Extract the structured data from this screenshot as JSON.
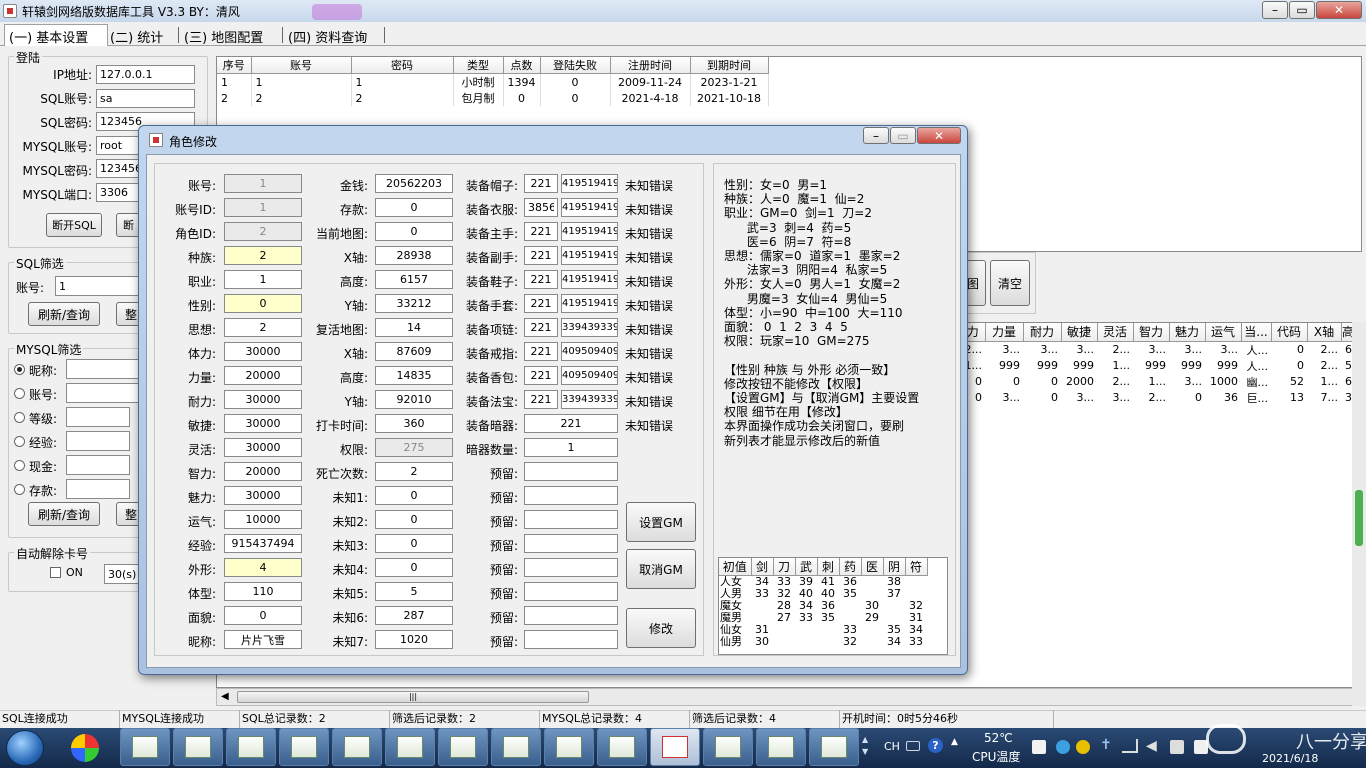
{
  "window": {
    "title": "轩辕剑网络版数据库工具 V3.3      BY：清风"
  },
  "tabs": [
    "(一) 基本设置",
    "(二) 统计",
    "(三) 地图配置",
    "(四) 资料查询"
  ],
  "login": {
    "group": "登陆",
    "fields": [
      {
        "label": "IP地址:",
        "value": "127.0.0.1"
      },
      {
        "label": "SQL账号:",
        "value": "sa"
      },
      {
        "label": "SQL密码:",
        "value": "123456"
      },
      {
        "label": "MYSQL账号:",
        "value": "root"
      },
      {
        "label": "MYSQL密码:",
        "value": "123456"
      },
      {
        "label": "MYSQL端口:",
        "value": "3306"
      }
    ],
    "disconnect_btn": "断开SQL",
    "disconnect2_btn": "断"
  },
  "sql_filter": {
    "group": "SQL筛选",
    "account_label": "账号:",
    "account_value": "1",
    "refresh_btn": "刷新/查询",
    "other_btn": "整"
  },
  "mysql_filter": {
    "group": "MYSQL筛选",
    "options": [
      "昵称:",
      "账号:",
      "等级:",
      "经验:",
      "现金:",
      "存款:"
    ],
    "refresh_btn": "刷新/查询",
    "other_btn": "整"
  },
  "auto_unlock": {
    "group": "自动解除卡号",
    "checkbox": "ON",
    "interval": "30(s)"
  },
  "sql_table": {
    "headers": [
      "序号",
      "账号",
      "密码",
      "类型",
      "点数",
      "登陆失败",
      "注册时间",
      "到期时间"
    ],
    "rows": [
      [
        "1",
        "1",
        "1",
        "小时制",
        "1394",
        "0",
        "2009-11-24",
        "2023-1-21"
      ],
      [
        "2",
        "2",
        "2",
        "包月制",
        "0",
        "0",
        "2021-4-18",
        "2021-10-18"
      ]
    ]
  },
  "right_buttons": {
    "partial": "图",
    "clear": "清空"
  },
  "mysql_table": {
    "headers": [
      "力",
      "力量",
      "耐力",
      "敏捷",
      "灵活",
      "智力",
      "魅力",
      "运气",
      "当...",
      "代码",
      "X轴",
      "高"
    ],
    "rows": [
      [
        "2...",
        "3...",
        "3...",
        "3...",
        "2...",
        "3...",
        "3...",
        "3...",
        "人...",
        "0",
        "2...",
        "6"
      ],
      [
        "1...",
        "999",
        "999",
        "999",
        "1...",
        "999",
        "999",
        "999",
        "人...",
        "0",
        "2...",
        "5"
      ],
      [
        "0",
        "0",
        "0",
        "2000",
        "2...",
        "1...",
        "3...",
        "1000",
        "幽...",
        "52",
        "1...",
        "6"
      ],
      [
        "0",
        "3...",
        "0",
        "3...",
        "3...",
        "2...",
        "0",
        "36",
        "巨...",
        "13",
        "7...",
        "3"
      ]
    ]
  },
  "dialog": {
    "title": "角色修改",
    "col1": [
      {
        "label": "账号:",
        "value": "1",
        "state": "dis"
      },
      {
        "label": "账号ID:",
        "value": "1",
        "state": "dis"
      },
      {
        "label": "角色ID:",
        "value": "2",
        "state": "dis"
      },
      {
        "label": "种族:",
        "value": "2",
        "state": "yel"
      },
      {
        "label": "职业:",
        "value": "1",
        "state": ""
      },
      {
        "label": "性别:",
        "value": "0",
        "state": "yel"
      },
      {
        "label": "思想:",
        "value": "2",
        "state": ""
      },
      {
        "label": "体力:",
        "value": "30000",
        "state": ""
      },
      {
        "label": "力量:",
        "value": "20000",
        "state": ""
      },
      {
        "label": "耐力:",
        "value": "30000",
        "state": ""
      },
      {
        "label": "敏捷:",
        "value": "30000",
        "state": ""
      },
      {
        "label": "灵活:",
        "value": "30000",
        "state": ""
      },
      {
        "label": "智力:",
        "value": "20000",
        "state": ""
      },
      {
        "label": "魅力:",
        "value": "30000",
        "state": ""
      },
      {
        "label": "运气:",
        "value": "10000",
        "state": ""
      },
      {
        "label": "经验:",
        "value": "915437494",
        "state": ""
      },
      {
        "label": "外形:",
        "value": "4",
        "state": "yel"
      },
      {
        "label": "体型:",
        "value": "110",
        "state": ""
      },
      {
        "label": "面貌:",
        "value": "0",
        "state": ""
      },
      {
        "label": "昵称:",
        "value": "片片飞雪",
        "state": ""
      }
    ],
    "col2": [
      {
        "label": "金钱:",
        "value": "20562203",
        "state": ""
      },
      {
        "label": "存款:",
        "value": "0",
        "state": ""
      },
      {
        "label": "当前地图:",
        "value": "0",
        "state": ""
      },
      {
        "label": "X轴:",
        "value": "28938",
        "state": ""
      },
      {
        "label": "高度:",
        "value": "6157",
        "state": ""
      },
      {
        "label": "Y轴:",
        "value": "33212",
        "state": ""
      },
      {
        "label": "复活地图:",
        "value": "14",
        "state": ""
      },
      {
        "label": "X轴:",
        "value": "87609",
        "state": ""
      },
      {
        "label": "高度:",
        "value": "14835",
        "state": ""
      },
      {
        "label": "Y轴:",
        "value": "92010",
        "state": ""
      },
      {
        "label": "打卡时间:",
        "value": "360",
        "state": ""
      },
      {
        "label": "权限:",
        "value": "275",
        "state": "dis"
      },
      {
        "label": "死亡次数:",
        "value": "2",
        "state": ""
      },
      {
        "label": "未知1:",
        "value": "0",
        "state": ""
      },
      {
        "label": "未知2:",
        "value": "0",
        "state": ""
      },
      {
        "label": "未知3:",
        "value": "0",
        "state": ""
      },
      {
        "label": "未知4:",
        "value": "0",
        "state": ""
      },
      {
        "label": "未知5:",
        "value": "5",
        "state": ""
      },
      {
        "label": "未知6:",
        "value": "287",
        "state": ""
      },
      {
        "label": "未知7:",
        "value": "1020",
        "state": ""
      }
    ],
    "equip": [
      {
        "label": "装备帽子:",
        "a": "221",
        "b": "419519419",
        "status": "未知错误"
      },
      {
        "label": "装备衣服:",
        "a": "3856",
        "b": "419519419",
        "status": "未知错误"
      },
      {
        "label": "装备主手:",
        "a": "221",
        "b": "419519419",
        "status": "未知错误"
      },
      {
        "label": "装备副手:",
        "a": "221",
        "b": "419519419",
        "status": "未知错误"
      },
      {
        "label": "装备鞋子:",
        "a": "221",
        "b": "419519419",
        "status": "未知错误"
      },
      {
        "label": "装备手套:",
        "a": "221",
        "b": "419519419",
        "status": "未知错误"
      },
      {
        "label": "装备项链:",
        "a": "221",
        "b": "339439339",
        "status": "未知错误"
      },
      {
        "label": "装备戒指:",
        "a": "221",
        "b": "409509409",
        "status": "未知错误"
      },
      {
        "label": "装备香包:",
        "a": "221",
        "b": "409509409",
        "status": "未知错误"
      },
      {
        "label": "装备法宝:",
        "a": "221",
        "b": "339439339",
        "status": "未知错误"
      }
    ],
    "hidden_weapon": {
      "label": "装备暗器:",
      "value": "221",
      "status": "未知错误"
    },
    "hidden_count": {
      "label": "暗器数量:",
      "value": "1"
    },
    "reserved_label": "预留:",
    "buttons": {
      "set_gm": "设置GM",
      "cancel_gm": "取消GM",
      "modify": "修改"
    },
    "info": [
      "性别：女=0  男=1",
      "种族：人=0  魔=1  仙=2",
      "职业：GM=0  剑=1  刀=2",
      "      武=3  刺=4  药=5",
      "      医=6  阴=7  符=8",
      "思想：儒家=0  道家=1  墨家=2",
      "      法家=3  阴阳=4  私家=5",
      "外形：女人=0  男人=1  女魔=2",
      "      男魔=3  女仙=4  男仙=5",
      "体型：小=90  中=100  大=110",
      "面貌： 0  1  2  3  4  5",
      "权限：玩家=10  GM=275",
      "",
      "【性别 种族 与 外形 必须一致】",
      "修改按钮不能修改【权限】",
      "【设置GM】与【取消GM】主要设置",
      "权限 细节在用【修改】",
      "本界面操作成功会关闭窗口，要刷",
      "新列表才能显示修改后的新值"
    ],
    "init_table": {
      "headers": [
        "初值",
        "剑",
        "刀",
        "武",
        "刺",
        "药",
        "医",
        "阴",
        "符"
      ],
      "rows": [
        [
          "人女",
          "34",
          "33",
          "39",
          "41",
          "36",
          "",
          "38",
          ""
        ],
        [
          "人男",
          "33",
          "32",
          "40",
          "40",
          "35",
          "",
          "37",
          ""
        ],
        [
          "魔女",
          "",
          "28",
          "34",
          "36",
          "",
          "30",
          "",
          "32"
        ],
        [
          "魔男",
          "",
          "27",
          "33",
          "35",
          "",
          "29",
          "",
          "31"
        ],
        [
          "仙女",
          "31",
          "",
          "",
          "",
          "33",
          "",
          "35",
          "34"
        ],
        [
          "仙男",
          "30",
          "",
          "",
          "",
          "32",
          "",
          "34",
          "33"
        ]
      ]
    }
  },
  "status_bar": [
    "SQL连接成功",
    "MYSQL连接成功",
    "SQL总记录数：2",
    "筛选后记录数：2",
    "MYSQL总记录数：4",
    "筛选后记录数：4",
    "开机时间：0时5分46秒"
  ],
  "taskbar": {
    "temp": "52℃",
    "temp_label": "CPU温度",
    "lang": "CH",
    "date": "2021/6/18",
    "watermark": "八一分享"
  },
  "colors": {
    "title_glass": "#c7d8ec",
    "taskbar": "#1d3a60",
    "input_yellow": "#ffffcc",
    "close_red": "#c9463d"
  }
}
